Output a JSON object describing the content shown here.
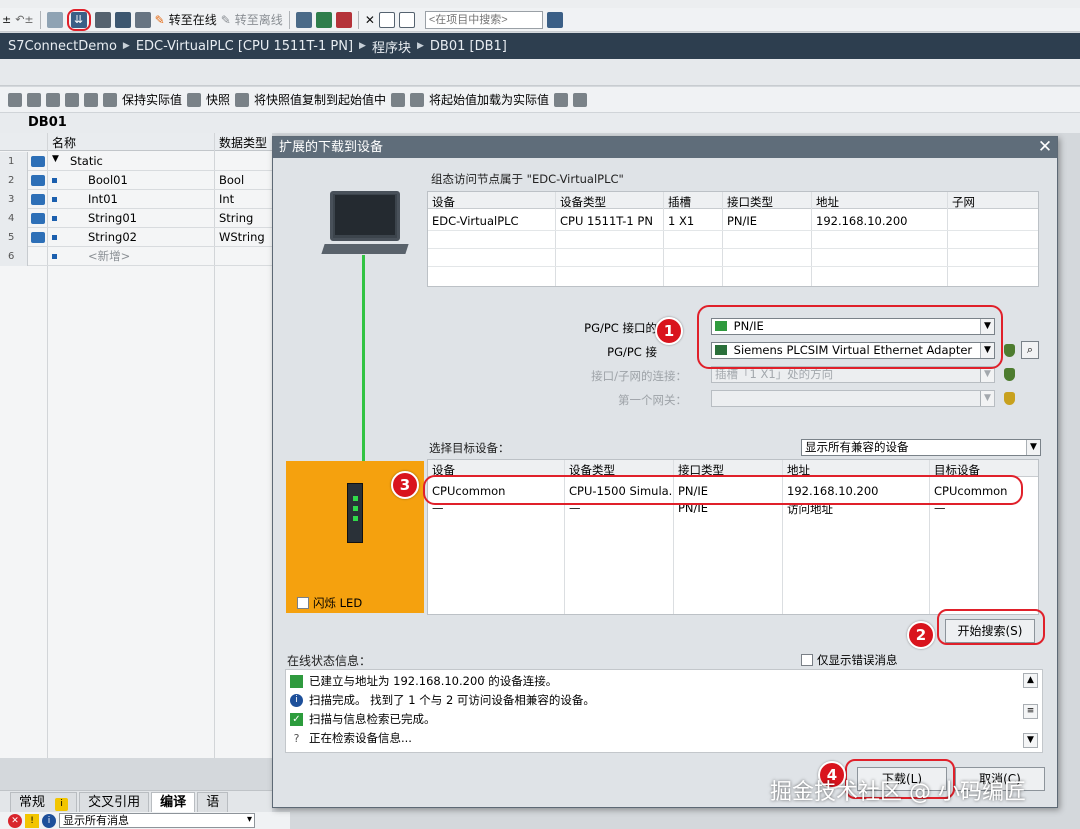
{
  "toolbar": {
    "go_online": "转至在线",
    "go_offline": "转至离线",
    "search_placeholder": "<在项目中搜索>"
  },
  "breadcrumb": [
    "S7ConnectDemo",
    "EDC-VirtualPLC [CPU 1511T-1 PN]",
    "程序块",
    "DB01 [DB1]"
  ],
  "db_toolbar": {
    "keep_actual": "保持实际值",
    "snapshot": "快照",
    "copy_snapshot": "将快照值复制到起始值中",
    "load_start": "将起始值加载为实际值"
  },
  "editor": {
    "title": "DB01",
    "col_name": "名称",
    "col_type": "数据类型",
    "rows": [
      {
        "num": "1",
        "name": "Static",
        "type": ""
      },
      {
        "num": "2",
        "name": "Bool01",
        "type": "Bool"
      },
      {
        "num": "3",
        "name": "Int01",
        "type": "Int"
      },
      {
        "num": "4",
        "name": "String01",
        "type": "String"
      },
      {
        "num": "5",
        "name": "String02",
        "type": "WString"
      },
      {
        "num": "6",
        "name": "<新增>",
        "type": ""
      }
    ]
  },
  "bottom": {
    "tabs": [
      "常规",
      "交叉引用",
      "编译",
      "语"
    ],
    "filter": "显示所有消息"
  },
  "dialog": {
    "title": "扩展的下载到设备",
    "flash_led": "闪烁 LED",
    "node_caption": "组态访问节点属于 \"EDC-VirtualPLC\"",
    "config_headers": [
      "设备",
      "设备类型",
      "插槽",
      "接口类型",
      "地址",
      "子网"
    ],
    "config_row": [
      "EDC-VirtualPLC",
      "CPU 1511T-1 PN",
      "1 X1",
      "PN/IE",
      "192.168.10.200",
      ""
    ],
    "pgpc_iface_type_label": "PG/PC 接口的",
    "pgpc_iface_type_value": "PN/IE",
    "pgpc_iface_label": "PG/PC 接",
    "pgpc_iface_value": "Siemens PLCSIM Virtual Ethernet Adapter",
    "subnet_conn_label": "接口/子网的连接：",
    "subnet_conn_value": "插槽「1 X1」处的方向",
    "gateway_label": "第一个网关：",
    "target_label": "选择目标设备：",
    "target_filter": "显示所有兼容的设备",
    "target_headers": [
      "设备",
      "设备类型",
      "接口类型",
      "地址",
      "目标设备"
    ],
    "target_rows": [
      [
        "CPUcommon",
        "CPU-1500 Simula...",
        "PN/IE",
        "192.168.10.200",
        "CPUcommon"
      ],
      [
        "—",
        "—",
        "PN/IE",
        "访问地址",
        "—"
      ]
    ],
    "start_search": "开始搜索(S)",
    "status_label": "在线状态信息：",
    "only_errors": "仅显示错误消息",
    "status_lines": [
      "已建立与地址为 192.168.10.200 的设备连接。",
      "扫描完成。 找到了 1 个与 2 可访问设备相兼容的设备。",
      "扫描与信息检索已完成。",
      "正在检索设备信息..."
    ],
    "download_btn": "下载(L)",
    "cancel_btn": "取消(C)"
  },
  "badges": [
    "1",
    "2",
    "3",
    "4"
  ],
  "watermark": "掘金技术社区 @ 小码编匠",
  "colors": {
    "highlight_red": "#e0202a",
    "badge_red": "#d9141d",
    "orange": "#f5a10e",
    "link_green": "#32c443",
    "breadcrumb_bg": "#2d3e4f"
  }
}
